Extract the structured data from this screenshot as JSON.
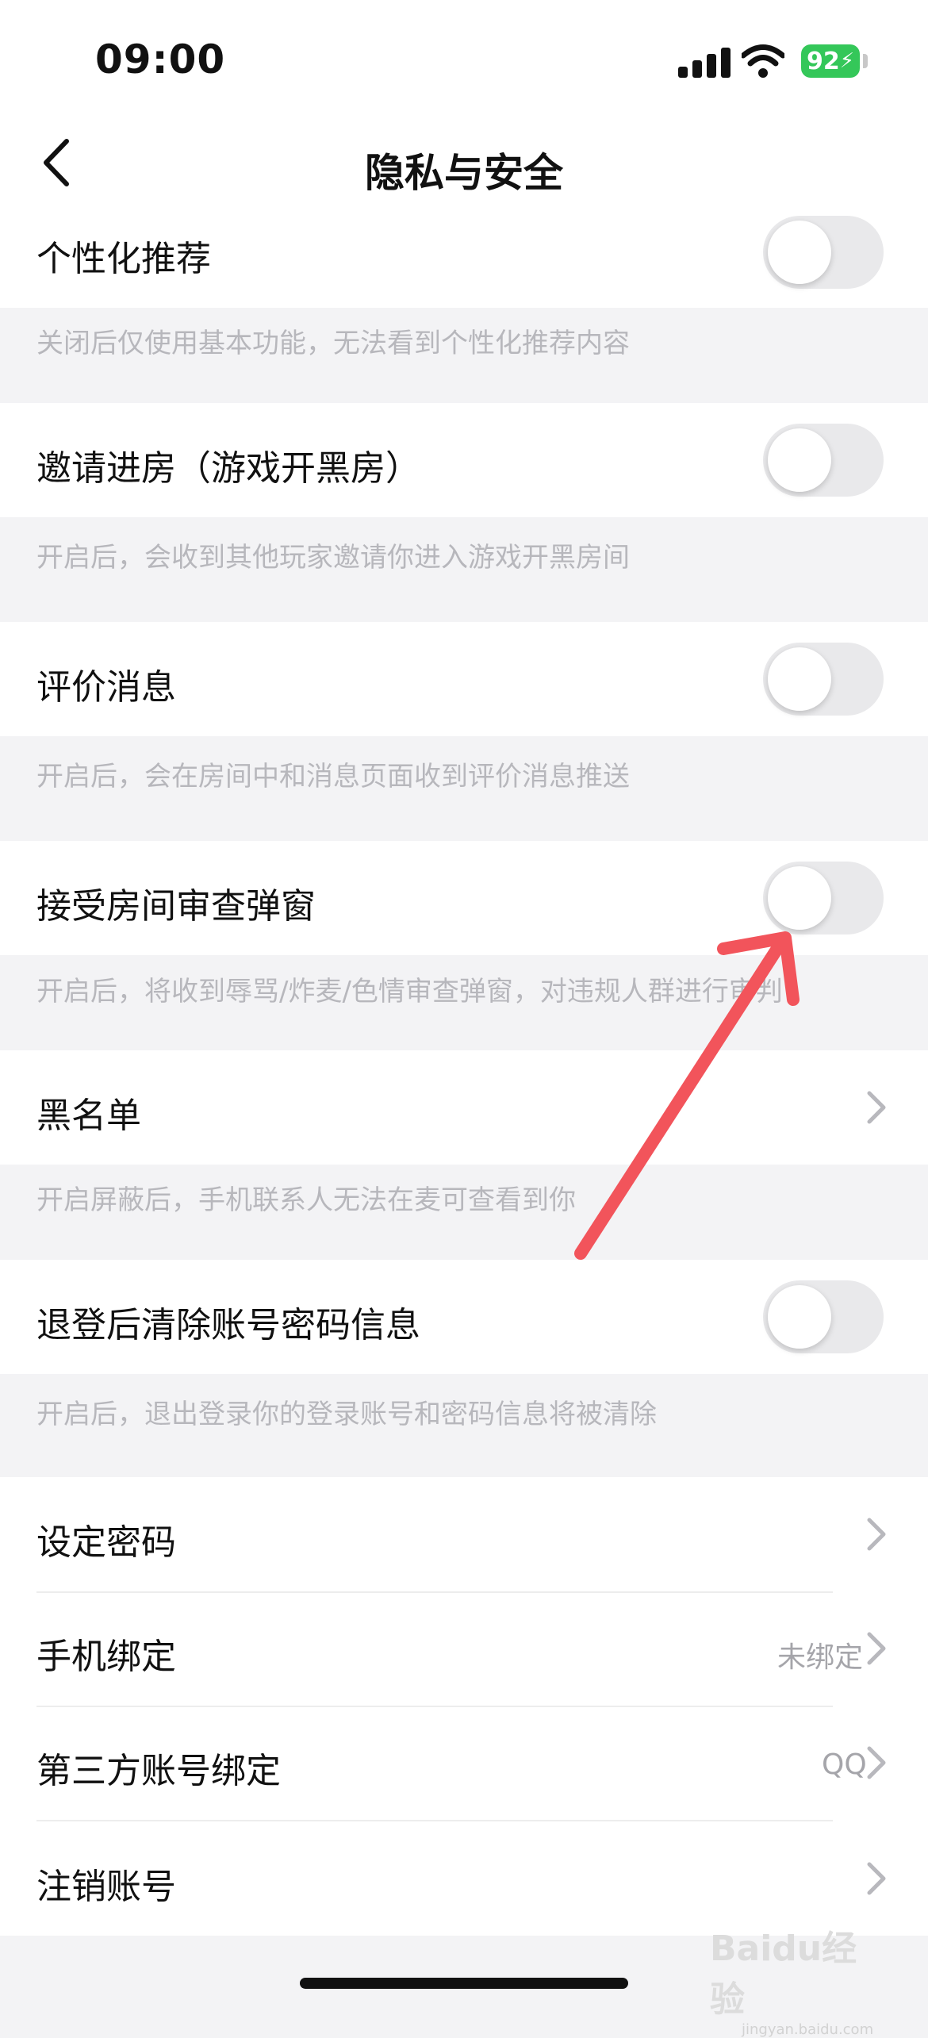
{
  "status_bar": {
    "time": "09:00",
    "battery": "92"
  },
  "header": {
    "title": "隐私与安全"
  },
  "settings": [
    {
      "label": "个性化推荐",
      "desc": "关闭后仅使用基本功能，无法看到个性化推荐内容",
      "toggle_on": false
    },
    {
      "label": "邀请进房（游戏开黑房）",
      "desc": "开启后，会收到其他玩家邀请你进入游戏开黑房间",
      "toggle_on": false
    },
    {
      "label": "评价消息",
      "desc": "开启后，会在房间中和消息页面收到评价消息推送",
      "toggle_on": false
    },
    {
      "label": "接受房间审查弹窗",
      "desc": "开启后，将收到辱骂/炸麦/色情审查弹窗，对违规人群进行审判",
      "toggle_on": false
    },
    {
      "label": "黑名单",
      "desc": "开启屏蔽后，手机联系人无法在麦可查看到你"
    },
    {
      "label": "退登后清除账号密码信息",
      "desc": "开启后，退出登录你的登录账号和密码信息将被清除",
      "toggle_on": false
    }
  ],
  "account": [
    {
      "label": "设定密码",
      "value": ""
    },
    {
      "label": "手机绑定",
      "value": "未绑定"
    },
    {
      "label": "第三方账号绑定",
      "value": "QQ"
    },
    {
      "label": "注销账号",
      "value": ""
    }
  ],
  "watermark": {
    "brand": "Baidu经验",
    "url": "jingyan.baidu.com"
  },
  "colors": {
    "toggle_off": "#e9e9eb",
    "battery": "#34c759",
    "annotation_arrow": "#f2545b"
  }
}
